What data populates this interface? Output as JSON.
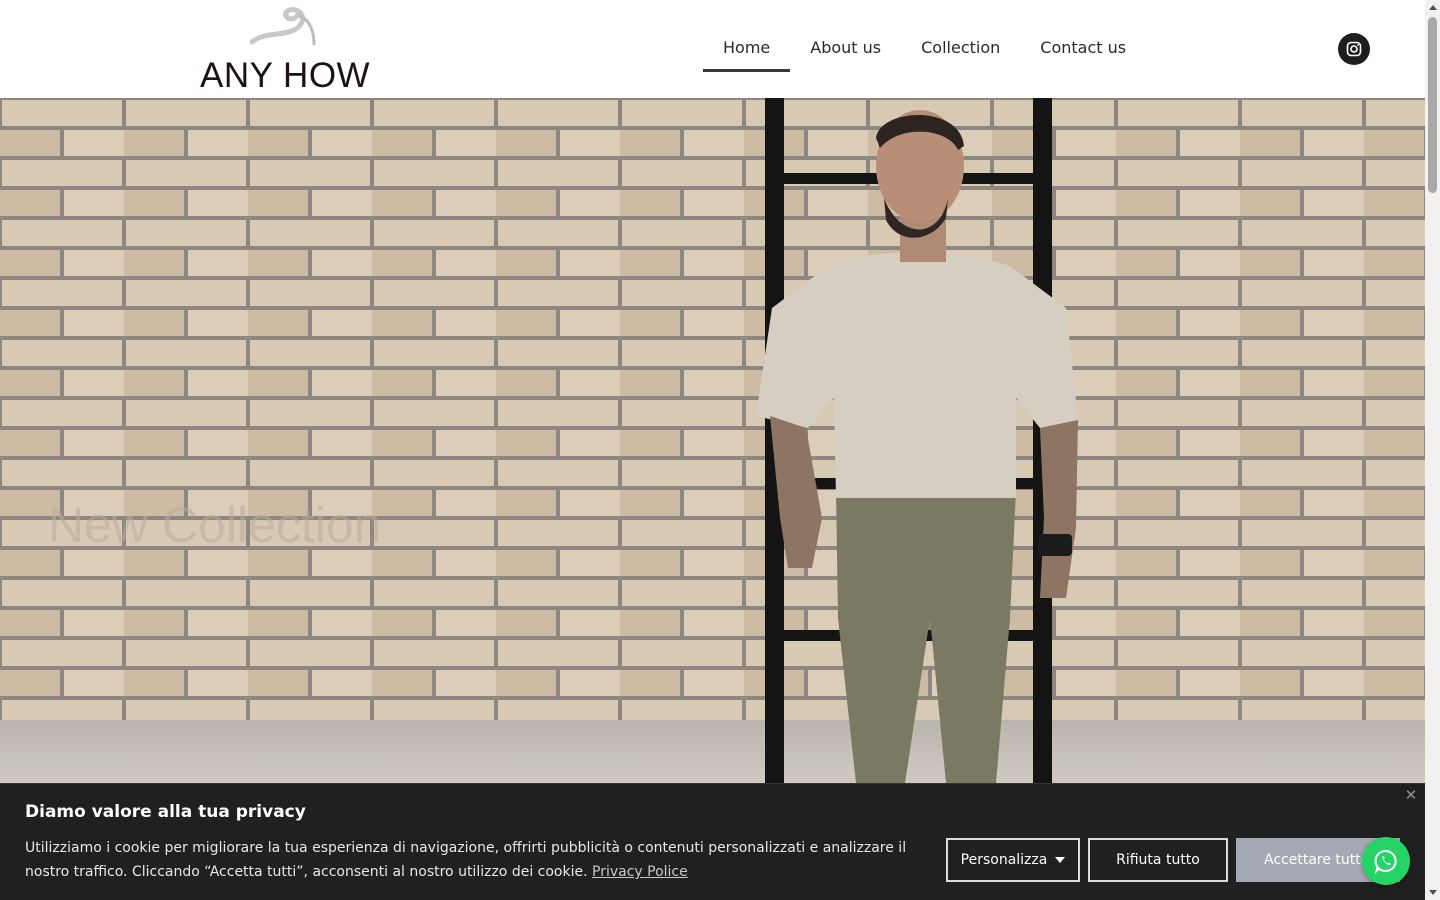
{
  "brand": {
    "logo_text": "ANY HOW"
  },
  "nav": {
    "items": [
      {
        "label": "Home",
        "active": true
      },
      {
        "label": "About us",
        "active": false
      },
      {
        "label": "Collection",
        "active": false
      },
      {
        "label": "Contact us",
        "active": false
      }
    ],
    "social_icon": "instagram-icon"
  },
  "hero": {
    "title": "New Collection"
  },
  "cookie_banner": {
    "title": "Diamo valore alla tua privacy",
    "text": "Utilizziamo i cookie per migliorare la tua esperienza di navigazione, offrirti pubblicità o contenuti personalizzati e analizzare il nostro traffico. Cliccando “Accetta tutti”, acconsenti al nostro utilizzo dei cookie.",
    "policy_link": "Privacy Police",
    "customize_label": "Personalizza",
    "reject_label": "Rifiuta tutto",
    "accept_label": "Accettare tutto",
    "close_icon": "close-icon"
  },
  "floating": {
    "icon": "whatsapp-icon"
  },
  "colors": {
    "header_bg": "#ffffff",
    "banner_bg": "#202020",
    "accept_bg": "#a4a9b3",
    "whatsapp": "#25d366",
    "brick": "#d2c2ac"
  }
}
